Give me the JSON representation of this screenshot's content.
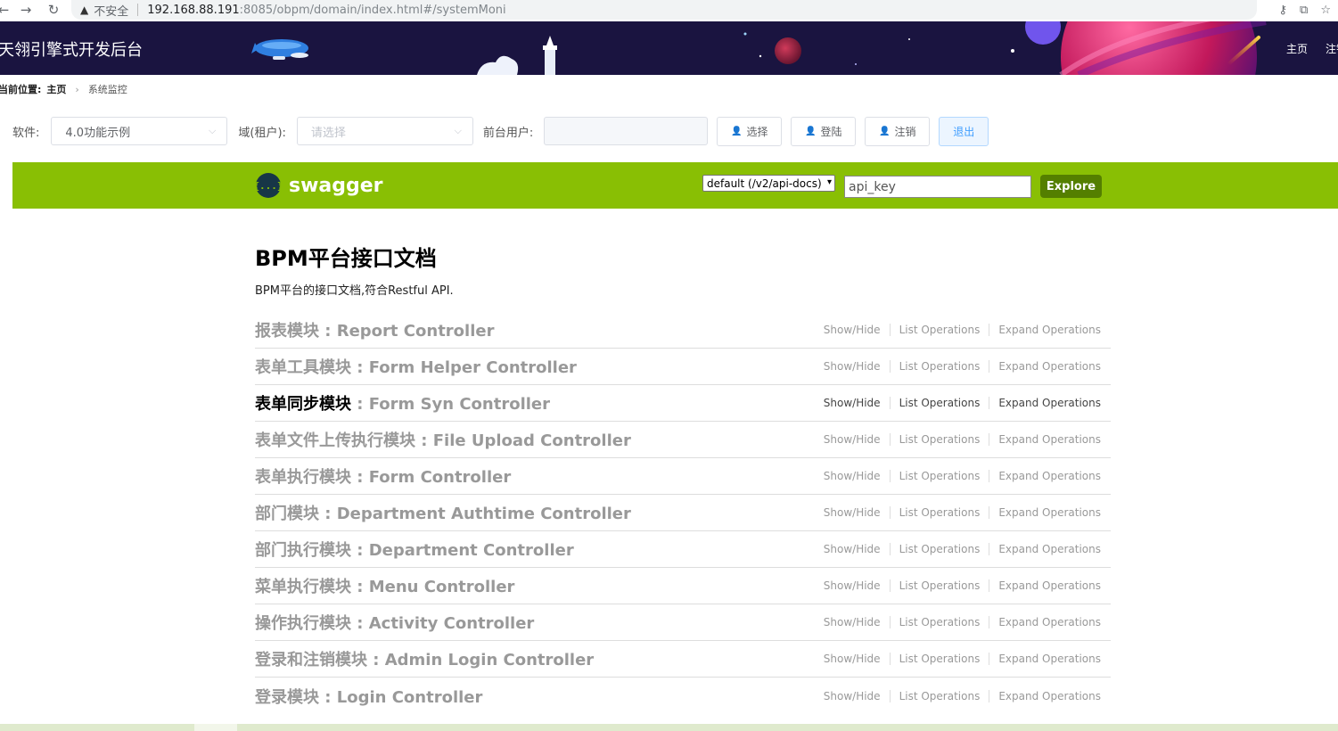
{
  "browser": {
    "insecure_label": "不安全",
    "url_host": "192.168.88.191",
    "url_rest": ":8085/obpm/domain/index.html#/systemMoni"
  },
  "header": {
    "title": "天翎引擎式开发后台",
    "nav": [
      "主页",
      "注销"
    ]
  },
  "breadcrumb": {
    "label": "当前位置:",
    "home": "主页",
    "current": "系统监控"
  },
  "filters": {
    "software_label": "软件:",
    "software_value": "4.0功能示例",
    "domain_label": "域(租户):",
    "domain_placeholder": "请选择",
    "user_label": "前台用户:",
    "user_value": "",
    "buttons": {
      "select": "选择",
      "login": "登陆",
      "logout_user": "注销",
      "exit": "退出"
    }
  },
  "swagger": {
    "logo_text": "swagger",
    "logo_glyph": "{...}",
    "api_select": "default (/v2/api-docs)",
    "api_key_placeholder": "api_key",
    "explore": "Explore",
    "colors": {
      "bar": "#89bf04",
      "explore": "#547f00"
    }
  },
  "doc": {
    "title": "BPM平台接口文档",
    "description": "BPM平台的接口文档,符合Restful API."
  },
  "ops_labels": {
    "show_hide": "Show/Hide",
    "list": "List Operations",
    "expand": "Expand Operations"
  },
  "resources": [
    {
      "cn": "报表模块",
      "en": " : Report Controller"
    },
    {
      "cn": "表单工具模块",
      "en": " : Form Helper Controller"
    },
    {
      "cn": "表单同步模块",
      "en": " : Form Syn Controller"
    },
    {
      "cn": "表单文件上传执行模块",
      "en": " : File Upload Controller"
    },
    {
      "cn": "表单执行模块",
      "en": " : Form Controller"
    },
    {
      "cn": "部门模块",
      "en": " : Department Authtime Controller"
    },
    {
      "cn": "部门执行模块",
      "en": " : Department Controller"
    },
    {
      "cn": "菜单执行模块",
      "en": " : Menu Controller"
    },
    {
      "cn": "操作执行模块",
      "en": " : Activity Controller"
    },
    {
      "cn": "登录和注销模块",
      "en": " : Admin Login Controller"
    },
    {
      "cn": "登录模块",
      "en": " : Login Controller"
    }
  ]
}
